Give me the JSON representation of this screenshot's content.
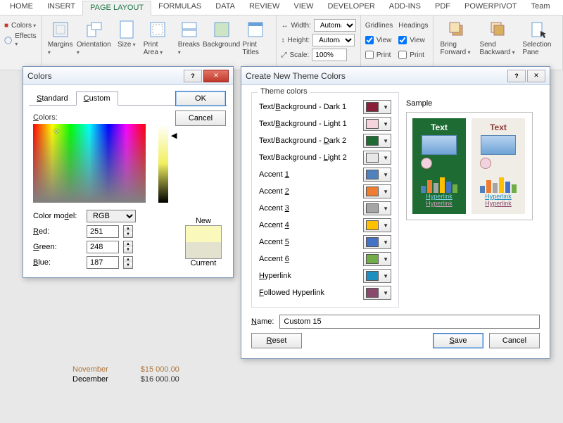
{
  "tabs": {
    "home": "HOME",
    "insert": "INSERT",
    "page_layout": "PAGE LAYOUT",
    "formulas": "FORMULAS",
    "data": "DATA",
    "review": "REVIEW",
    "view": "VIEW",
    "developer": "DEVELOPER",
    "addins": "ADD-INS",
    "pdf": "PDF",
    "powerpivot": "POWERPIVOT",
    "team": "Team"
  },
  "ribbon": {
    "colors": "Colors",
    "effects": "Effects",
    "margins": "Margins",
    "orientation": "Orientation",
    "size": "Size",
    "print_area": "Print Area",
    "breaks": "Breaks",
    "background": "Background",
    "print_titles": "Print Titles",
    "width": "Width:",
    "height": "Height:",
    "scale": "Scale:",
    "width_val": "Automatic",
    "height_val": "Automatic",
    "scale_val": "100%",
    "gridlines": "Gridlines",
    "headings": "Headings",
    "view": "View",
    "print": "Print",
    "bring_forward": "Bring Forward",
    "send_backward": "Send Backward",
    "selection_pane": "Selection Pane"
  },
  "sheet": {
    "november": "November",
    "nov_val": "$15 000.00",
    "december": "December",
    "dec_val": "$16 000.00"
  },
  "colors_dlg": {
    "title": "Colors",
    "tab_standard": "Standard",
    "tab_custom": "Custom",
    "ok": "OK",
    "cancel": "Cancel",
    "colors_label": "Colors:",
    "color_model": "Color model:",
    "model_val": "RGB",
    "red": "Red:",
    "green": "Green:",
    "blue": "Blue:",
    "red_val": "251",
    "green_val": "248",
    "blue_val": "187",
    "new": "New",
    "current": "Current"
  },
  "theme_dlg": {
    "title": "Create New Theme Colors",
    "group_theme": "Theme colors",
    "group_sample": "Sample",
    "items": [
      {
        "label": "Text/Background - Dark 1",
        "under": "B",
        "color": "#8a1f3a"
      },
      {
        "label": "Text/Background - Light 1",
        "under": "B",
        "color": "#f6d4de"
      },
      {
        "label": "Text/Background - Dark 2",
        "under": "D",
        "color": "#1e6b34"
      },
      {
        "label": "Text/Background - Light 2",
        "under": "L",
        "color": "#e7e7e7"
      },
      {
        "label": "Accent 1",
        "under": "1",
        "color": "#4f81bd"
      },
      {
        "label": "Accent 2",
        "under": "2",
        "color": "#ed7d31"
      },
      {
        "label": "Accent 3",
        "under": "3",
        "color": "#a5a5a5"
      },
      {
        "label": "Accent 4",
        "under": "4",
        "color": "#ffc000"
      },
      {
        "label": "Accent 5",
        "under": "5",
        "color": "#4472c4"
      },
      {
        "label": "Accent 6",
        "under": "6",
        "color": "#70ad47"
      },
      {
        "label": "Hyperlink",
        "under": "H",
        "color": "#1f8fbf"
      },
      {
        "label": "Followed Hyperlink",
        "under": "F",
        "color": "#8a4a6b"
      }
    ],
    "sample_text": "Text",
    "hyperlink": "Hyperlink",
    "followed": "Hyperlink",
    "name_label": "Name:",
    "name_val": "Custom 15",
    "reset": "Reset",
    "save": "Save",
    "cancel": "Cancel"
  },
  "bar_colors": [
    "#4f81bd",
    "#ed7d31",
    "#a5a5a5",
    "#ffc000",
    "#4472c4",
    "#70ad47"
  ]
}
